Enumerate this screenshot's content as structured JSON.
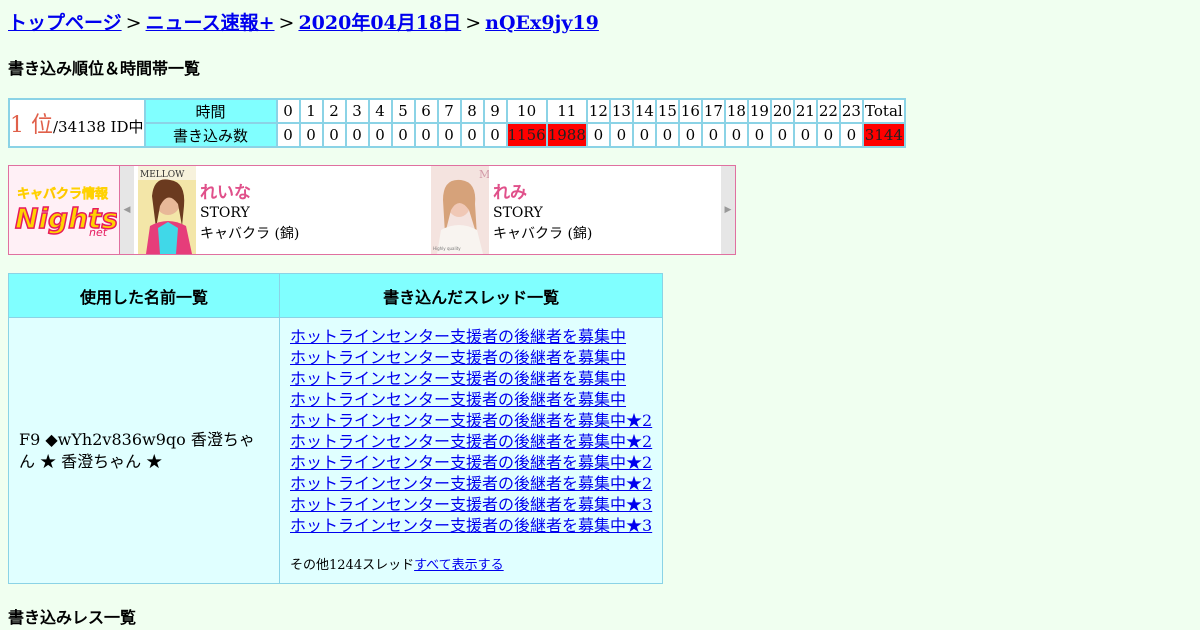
{
  "breadcrumb": {
    "items": [
      "トップページ",
      "ニュース速報+",
      "2020年04月18日",
      "nQEx9jy19"
    ],
    "separator": ">"
  },
  "rank_section": {
    "heading": "書き込み順位＆時間帯一覧",
    "rank": "1 位",
    "rank_suffix": "/34138 ID中",
    "time_label": "時間",
    "count_label": "書き込み数",
    "hours": [
      "0",
      "1",
      "2",
      "3",
      "4",
      "5",
      "6",
      "7",
      "8",
      "9",
      "10",
      "11",
      "12",
      "13",
      "14",
      "15",
      "16",
      "17",
      "18",
      "19",
      "20",
      "21",
      "22",
      "23"
    ],
    "total_label": "Total",
    "counts": [
      "0",
      "0",
      "0",
      "0",
      "0",
      "0",
      "0",
      "0",
      "0",
      "0",
      "1156",
      "1988",
      "0",
      "0",
      "0",
      "0",
      "0",
      "0",
      "0",
      "0",
      "0",
      "0",
      "0",
      "0"
    ],
    "total": "3144",
    "highlight_color": "#ff0000"
  },
  "ad": {
    "logo_text": "キャバクラ情報 Nights.net",
    "cards": [
      {
        "name": "れいな",
        "store": "STORY",
        "type": "キャバクラ (錦)",
        "photo_label": "MELLOW"
      },
      {
        "name": "れみ",
        "store": "STORY",
        "type": "キャバクラ (錦)",
        "photo_label": "M"
      }
    ]
  },
  "main_table": {
    "names_header": "使用した名前一覧",
    "threads_header": "書き込んだスレッド一覧",
    "names": "F9 ◆wYh2v836w9qo 香澄ちゃん ★ 香澄ちゃん ★",
    "threads": [
      "ホットラインセンター支援者の後継者を募集中",
      "ホットラインセンター支援者の後継者を募集中",
      "ホットラインセンター支援者の後継者を募集中",
      "ホットラインセンター支援者の後継者を募集中",
      "ホットラインセンター支援者の後継者を募集中★2",
      "ホットラインセンター支援者の後継者を募集中★2",
      "ホットラインセンター支援者の後継者を募集中★2",
      "ホットラインセンター支援者の後継者を募集中★2",
      "ホットラインセンター支援者の後継者を募集中★3",
      "ホットラインセンター支援者の後継者を募集中★3"
    ],
    "more_text": "その他1244スレッド",
    "more_link": "すべて表示する"
  },
  "res_heading": "書き込みレス一覧"
}
